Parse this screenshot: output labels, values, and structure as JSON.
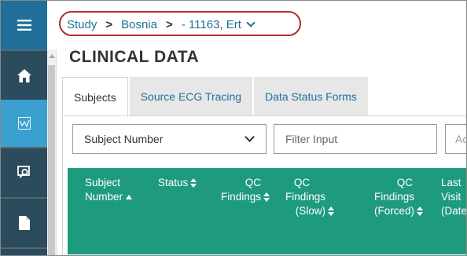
{
  "nav": {
    "items": [
      {
        "name": "menu",
        "icon": "hamburger-menu-icon"
      },
      {
        "name": "home",
        "icon": "home-icon"
      },
      {
        "name": "clinical-data",
        "icon": "chart-icon",
        "active": true
      },
      {
        "name": "search-reports",
        "icon": "search-document-icon"
      },
      {
        "name": "documents",
        "icon": "document-icon"
      }
    ]
  },
  "breadcrumb": {
    "study": "Study",
    "region": "Bosnia",
    "site": "- 11163, Ert"
  },
  "page": {
    "title": "CLINICAL DATA"
  },
  "tabs": [
    {
      "label": "Subjects",
      "active": true
    },
    {
      "label": "Source ECG Tracing",
      "active": false
    },
    {
      "label": "Data Status Forms",
      "active": false
    }
  ],
  "filters": {
    "field_select": "Subject Number",
    "filter_placeholder": "Filter Input",
    "extra_partial": "Ac"
  },
  "table": {
    "columns": [
      {
        "lines": [
          "Subject",
          "Number"
        ],
        "sort": "asc"
      },
      {
        "lines": [
          "Status"
        ],
        "sort": "both"
      },
      {
        "lines": [
          "QC",
          "Findings"
        ],
        "sort": "both"
      },
      {
        "lines": [
          "QC",
          "Findings",
          "(Slow)"
        ],
        "sort": "both"
      },
      {
        "lines": [
          "QC",
          "Findings",
          "(Forced)"
        ],
        "sort": "both"
      },
      {
        "lines": [
          "Last",
          "Visit",
          "(Date"
        ],
        "sort": "none"
      }
    ]
  },
  "colors": {
    "rail": "#2c4b5c",
    "rail_menu": "#1f6f99",
    "rail_active": "#3aa0cf",
    "link": "#1f6f99",
    "table_header": "#1e9a7f",
    "highlight_oval": "#b32b2b"
  }
}
